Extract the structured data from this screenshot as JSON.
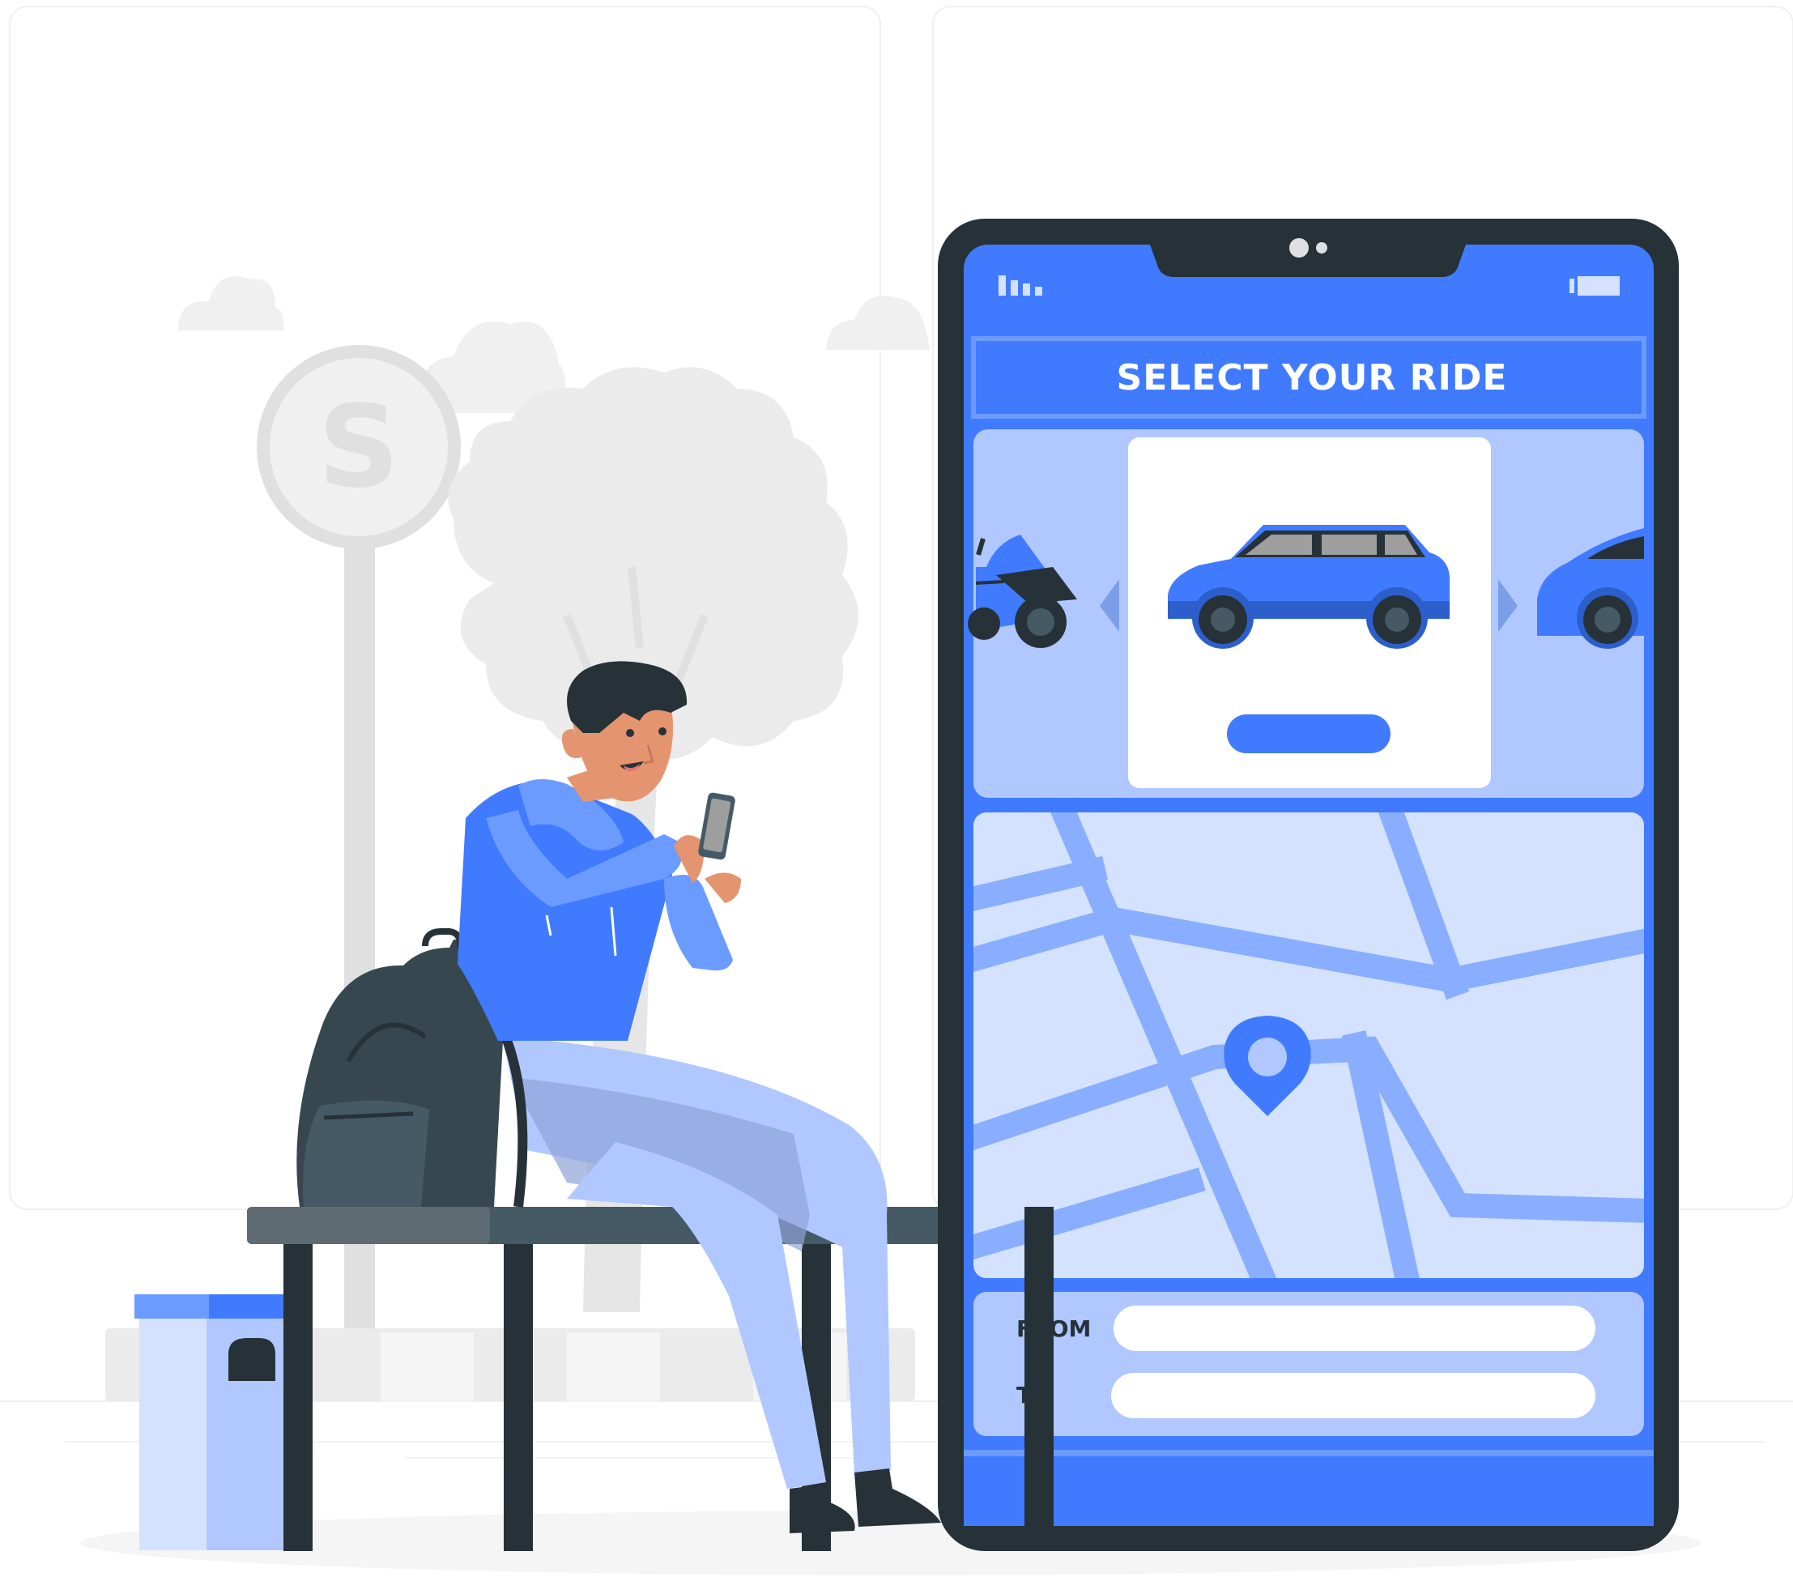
{
  "screen": {
    "title": "SELECT YOUR RIDE",
    "from_label": "FROM",
    "to_label": "TO"
  },
  "bus_stop_sign": "S",
  "icons": {
    "selected_vehicle": "car-icon",
    "prev_vehicle": "scooter-icon",
    "next_vehicle": "car-icon",
    "carousel_prev": "chevron-left-icon",
    "carousel_next": "chevron-right-icon",
    "map_pin": "map-pin-icon",
    "signal": "signal-icon",
    "battery": "battery-icon"
  },
  "colors": {
    "primary": "#407BFF",
    "light": "#B0C8FF",
    "pale": "#D4E2FF",
    "dark": "#263238",
    "grey_bg": "#EBEBEB"
  }
}
